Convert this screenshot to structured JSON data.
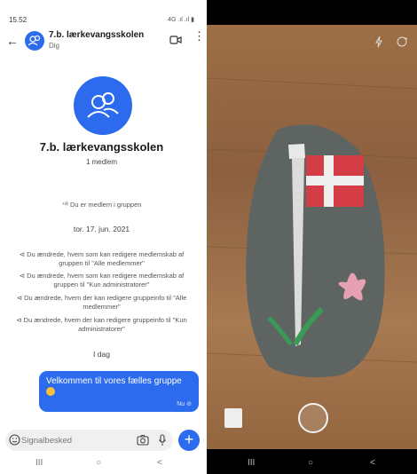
{
  "status": {
    "time": "15.52",
    "signal": "4G .ıl .ıl ▮"
  },
  "header": {
    "title": "7.b. lærkevangsskolen",
    "subtitle": "Dig",
    "back_label": "←",
    "more_label": "⋮"
  },
  "group": {
    "name": "7.b. lærkevangsskolen",
    "members": "1 medlem"
  },
  "system": {
    "member_note": "Du er medlem i gruppen",
    "date1": "tor. 17. jun. 2021",
    "events": [
      "Du ændrede, hvem som kan redigere medlemskab af gruppen til \"Alle medlemmer\"",
      "Du ændrede, hvem som kan redigere medlemskab af gruppen til \"Kun administratorer\"",
      "Du ændrede, hvem der kan redigere gruppeinfo til \"Alle medlemmer\"",
      "Du ændrede, hvem der kan redigere gruppeinfo til \"Kun administratorer\""
    ],
    "date2": "I dag"
  },
  "message": {
    "text": "Velkommen til vores fælles gruppe",
    "meta": "Nu ⊘"
  },
  "composer": {
    "placeholder": "Signalbesked",
    "plus_label": "+"
  },
  "nav": {
    "recent": "III",
    "home": "○",
    "back": "<"
  },
  "colors": {
    "accent": "#2c6bed",
    "bubble": "#2c6bed",
    "background": "#ffffff"
  },
  "icons": [
    "back-arrow-icon",
    "group-avatar-icon",
    "video-call-icon",
    "more-icon",
    "emoji-icon",
    "camera-icon",
    "mic-icon",
    "flash-icon",
    "flip-camera-icon"
  ]
}
